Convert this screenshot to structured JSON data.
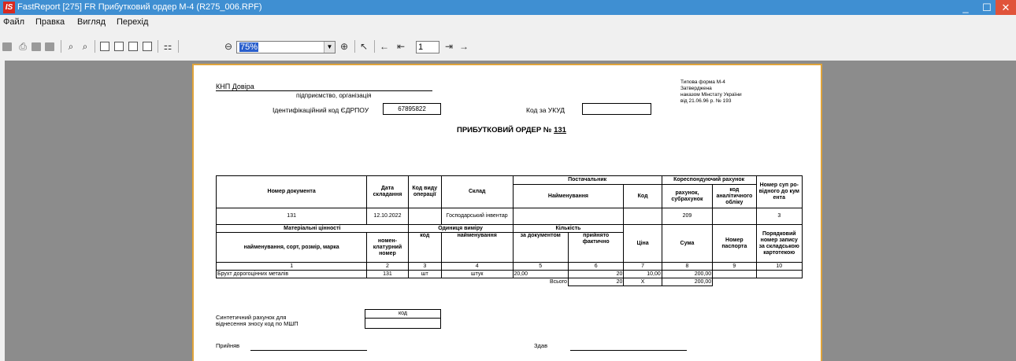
{
  "window": {
    "title": "FastReport [275] FR Прибутковий ордер М-4  (R275_006.RPF)",
    "app_icon": "IS"
  },
  "menu": [
    "Файл",
    "Правка",
    "Вигляд",
    "Перехід"
  ],
  "toolbar": {
    "zoom": "75%",
    "page": "1"
  },
  "report": {
    "org": "КНП Довіра",
    "org_caption": "підприємство, організація",
    "edrpou_label": "Ідентифікаційний код ЄДРПОУ",
    "edrpou": "67895822",
    "ukud_label": "Код за УКУД",
    "ukud": "",
    "typical_form": [
      "Типова форма М-4",
      "Затверджена",
      "наказом Мінстату України",
      "від 21.06.96 р. № 193"
    ],
    "title_prefix": "ПРИБУТКОВИЙ ОРДЕР №",
    "order_number": "131",
    "head": {
      "doc_number": "Номер документа",
      "date": "Дата складання",
      "op_code": "Код виду операції",
      "warehouse": "Склад",
      "supplier": "Постачальник",
      "supplier_name": "Найменування",
      "supplier_code": "Код",
      "corr": "Кореспондуючий рахунок",
      "corr_account": "рахунок, субрахунок",
      "corr_code": "код аналітичного обліку",
      "supporting_doc": "Номер суп ро-відного до кум ента"
    },
    "row1": {
      "doc_number": "131",
      "date": "12.10.2022",
      "op_code": "",
      "warehouse": "Господарський інвентар",
      "supplier_name": "",
      "supplier_code": "",
      "account": "209",
      "analytic": "",
      "supporting": "3"
    },
    "head2": {
      "valuables": "Матеріальні цінності",
      "valuables_name": "найменування, сорт, розмір, марка",
      "nomenclature": "номен-клатурний номер",
      "unit": "Одиниця виміру",
      "unit_code": "код",
      "unit_name": "найменування",
      "qty": "Кількість",
      "qty_doc": "за документом",
      "qty_fact": "прийнято фактично",
      "price": "Ціна",
      "sum": "Сума",
      "passport": "Номер паспорта",
      "card_no": "Порядковий номер запису за складською картотекою"
    },
    "col_numbers": [
      "1",
      "2",
      "3",
      "4",
      "5",
      "6",
      "7",
      "8",
      "9",
      "10"
    ],
    "items": [
      {
        "name": "Брухт дорогоцінних металів",
        "nomen": "131",
        "unit_code": "шт",
        "unit_name": "штук",
        "qty_doc": "20,00",
        "qty_fact": "20",
        "price": "10,00",
        "sum": "200,00",
        "passport": "",
        "card": ""
      }
    ],
    "total": {
      "label": "Всього",
      "qty": "20",
      "price": "Х",
      "sum": "200,00"
    },
    "synthetic_label": [
      "Синтетичний рахунок для",
      "віднесення зносу код по МШП"
    ],
    "code_label": "код",
    "accepted": "Прийняв",
    "handed": "Здав"
  }
}
